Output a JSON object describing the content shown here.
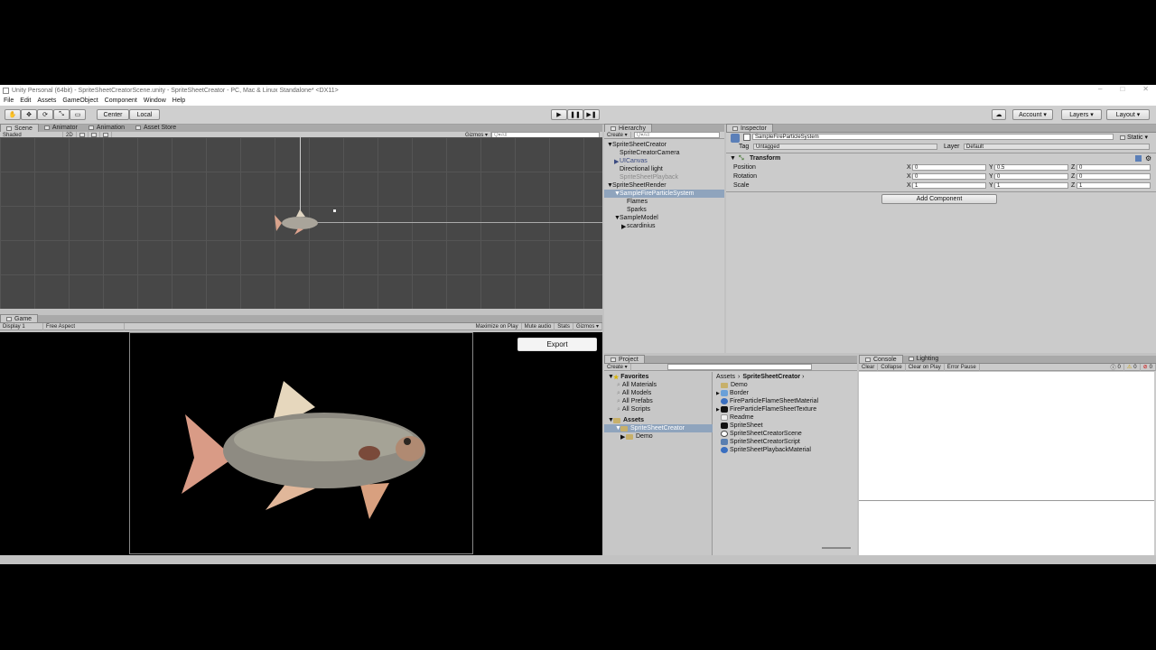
{
  "window": {
    "title": "Unity Personal (64bit) - SpriteSheetCreatorScene.unity - SpriteSheetCreator - PC, Mac & Linux Standalone* <DX11>",
    "controls": [
      "–",
      "□",
      "✕"
    ]
  },
  "menu": [
    "File",
    "Edit",
    "Assets",
    "GameObject",
    "Component",
    "Window",
    "Help"
  ],
  "toolbar": {
    "tools": [
      "✋",
      "✥",
      "⟳",
      "⤡",
      "▭"
    ],
    "pivot": "Center",
    "space": "Local",
    "play": "▶",
    "pause": "❚❚",
    "step": "▶❚",
    "cloud": "☁",
    "account": "Account ▾",
    "layers": "Layers ▾",
    "layout": "Layout ▾"
  },
  "scene_tabs": {
    "tabs": [
      "Scene",
      "Animator",
      "Animation",
      "Asset Store"
    ],
    "shading": "Shaded",
    "mode2d": "2D",
    "gizmos": "Gizmos ▾",
    "search_placeholder": "Q▾All"
  },
  "game_tab": {
    "tab": "Game",
    "display": "Display 1",
    "aspect": "Free Aspect",
    "options": [
      "Maximize on Play",
      "Mute audio",
      "Stats",
      "Gizmos ▾"
    ],
    "export_label": "Export"
  },
  "hierarchy": {
    "tab": "Hierarchy",
    "create": "Create ▾",
    "search_placeholder": "Q▾All",
    "items": [
      {
        "label": "SpriteSheetCreator",
        "arrow": "▼"
      },
      {
        "label": "SpriteCreatorCamera",
        "arrow": ""
      },
      {
        "label": "UICanvas",
        "arrow": "▶"
      },
      {
        "label": "Directional light",
        "arrow": ""
      },
      {
        "label": "SpriteSheetPlayback",
        "arrow": ""
      },
      {
        "label": "SpriteSheetRender",
        "arrow": "▼"
      },
      {
        "label": "SampleFireParticleSystem",
        "arrow": "▼"
      },
      {
        "label": "Flames",
        "arrow": ""
      },
      {
        "label": "Sparks",
        "arrow": ""
      },
      {
        "label": "SampleModel",
        "arrow": "▼"
      },
      {
        "label": "scardinius",
        "arrow": "▶"
      }
    ]
  },
  "inspector": {
    "tab": "Inspector",
    "object_name": "SampleFireParticleSystem",
    "static_label": "Static ▾",
    "tag_label": "Tag",
    "tag_value": "Untagged",
    "layer_label": "Layer",
    "layer_value": "Default",
    "component_title": "Transform",
    "rows": [
      {
        "label": "Position",
        "x": "0",
        "y": "0.5",
        "z": "0"
      },
      {
        "label": "Rotation",
        "x": "0",
        "y": "0",
        "z": "0"
      },
      {
        "label": "Scale",
        "x": "1",
        "y": "1",
        "z": "1"
      }
    ],
    "axis_labels": [
      "X",
      "Y",
      "Z"
    ],
    "add_component": "Add Component"
  },
  "project": {
    "tab": "Project",
    "create": "Create ▾",
    "favorites_title": "Favorites",
    "favorites": [
      "All Materials",
      "All Models",
      "All Prefabs",
      "All Scripts"
    ],
    "assets_title": "Assets",
    "tree": [
      "SpriteSheetCreator",
      "Demo"
    ],
    "breadcrumb_root": "Assets",
    "breadcrumb_current": "SpriteSheetCreator",
    "files": [
      {
        "name": "Demo",
        "kind": "folder"
      },
      {
        "name": "Border",
        "kind": "prefab"
      },
      {
        "name": "FireParticleFlameSheetMaterial",
        "kind": "material"
      },
      {
        "name": "FireParticleFlameSheetTexture",
        "kind": "texture"
      },
      {
        "name": "Readme",
        "kind": "doc"
      },
      {
        "name": "SpriteSheet",
        "kind": "texture"
      },
      {
        "name": "SpriteSheetCreatorScene",
        "kind": "scene"
      },
      {
        "name": "SpriteSheetCreatorScript",
        "kind": "script"
      },
      {
        "name": "SpriteSheetPlaybackMaterial",
        "kind": "material"
      }
    ]
  },
  "console": {
    "tabs": [
      "Console",
      "Lighting"
    ],
    "buttons": [
      "Clear",
      "Collapse",
      "Clear on Play",
      "Error Pause"
    ],
    "counts": [
      "0",
      "0",
      "0"
    ]
  },
  "colors": {
    "selection": "#8fa4bd",
    "scene_bg": "#474747",
    "panel_bg": "#cbcbcb"
  }
}
